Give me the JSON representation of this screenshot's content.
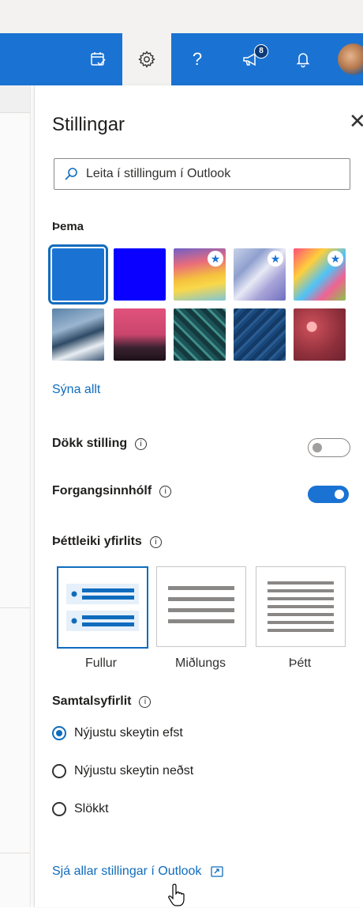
{
  "appbar": {
    "icons": [
      "calendar-check-icon",
      "settings-gear-icon",
      "help-icon",
      "megaphone-icon",
      "bell-icon",
      "avatar"
    ],
    "help_glyph": "?",
    "news_badge": "8"
  },
  "settings": {
    "title": "Stillingar",
    "close_glyph": "✕",
    "search_placeholder": "Leita í stillingum í Outlook",
    "theme_label": "Þema",
    "show_all": "Sýna allt",
    "dark_mode_label": "Dökk stilling",
    "dark_mode_on": false,
    "focused_inbox_label": "Forgangsinnhólf",
    "focused_inbox_on": true,
    "density_label": "Þéttleiki yfirlits",
    "density_options": [
      "Fullur",
      "Miðlungs",
      "Þétt"
    ],
    "density_selected": "Fullur",
    "conversation_label": "Samtalsyfirlit",
    "conversation_options": [
      "Nýjustu skeytin efst",
      "Nýjustu skeytin neðst",
      "Slökkt"
    ],
    "conversation_selected": "Nýjustu skeytin efst",
    "all_settings_link": "Sjá allar stillingar í Outlook",
    "info_glyph": "i",
    "accent_color": "#0f6cbd"
  }
}
